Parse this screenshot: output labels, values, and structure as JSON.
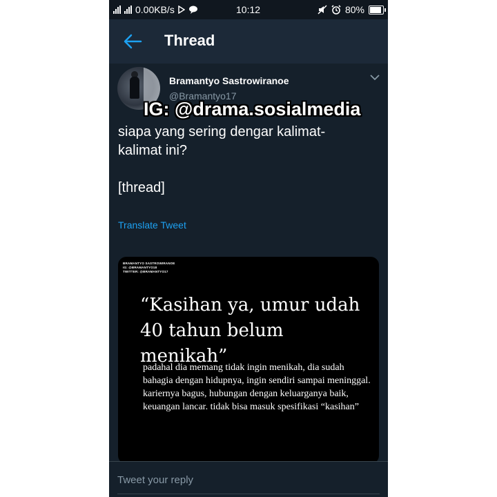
{
  "status_bar": {
    "network_speed": "0.00KB/s",
    "time": "10:12",
    "battery": "80%",
    "icons": [
      "signal-icon",
      "signal-icon",
      "data-icon",
      "play-store-icon",
      "chat-icon",
      "mute-icon",
      "alarm-icon",
      "battery-icon"
    ]
  },
  "header": {
    "title": "Thread",
    "back_icon": "back-arrow-icon"
  },
  "tweet": {
    "author_name": "Bramantyo Sastrowiranoe",
    "author_handle": "@Bramantyo17",
    "text_line1": "siapa yang sering dengar kalimat-",
    "text_line2": "kalimat ini?",
    "text_line3": "[thread]",
    "translate": "Translate Tweet"
  },
  "watermark": "IG: @drama.sosialmedia",
  "media": {
    "credit_line1": "BRAMANTYO SASTROWIRANOE",
    "credit_line2": "IG: @BRAMANTYO18",
    "credit_line3": "TWITTER: @BRAMANTYO17",
    "quote": "“Kasihan ya, umur udah 40 tahun belum menikah”",
    "body": "padahal dia memang tidak ingin menikah, dia sudah bahagia dengan hidupnya, ingin sendiri sampai meninggal. kariernya bagus, hubungan dengan keluarganya baik, keuangan lancar. tidak bisa masuk spesifikasi “kasihan”"
  },
  "reply": {
    "placeholder": "Tweet your reply"
  },
  "colors": {
    "background": "#15202b",
    "header": "#1c2938",
    "accent": "#1da1f2",
    "muted": "#8899a6"
  }
}
